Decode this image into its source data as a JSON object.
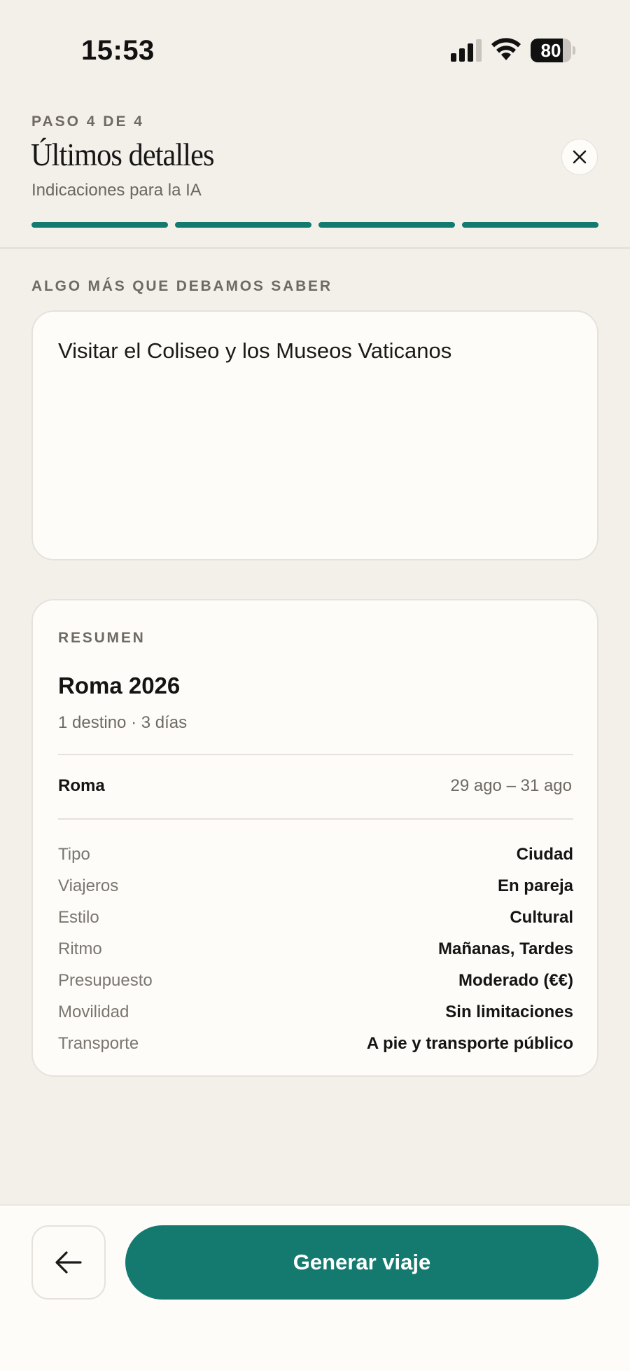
{
  "status_bar": {
    "time": "15:53",
    "battery_level": "80",
    "battery_fraction": 0.8,
    "icons": [
      "signal-icon",
      "wifi-icon",
      "battery-icon"
    ]
  },
  "header": {
    "step": "PASO 4 DE 4",
    "title": "Últimos detalles",
    "subtitle": "Indicaciones para la IA",
    "close_icon": "close-icon",
    "progress": {
      "completed_steps": 4,
      "total_steps": 4
    }
  },
  "notes": {
    "label": "ALGO MÁS QUE DEBAMOS SABER",
    "value": "Visitar el Coliseo y los Museos Vaticanos"
  },
  "summary": {
    "label": "RESUMEN",
    "trip_name": "Roma 2026",
    "trip_meta": "1 destino · 3 días",
    "destination": {
      "name": "Roma",
      "dates": "29 ago – 31 ago"
    },
    "details": [
      {
        "key": "Tipo",
        "value": "Ciudad"
      },
      {
        "key": "Viajeros",
        "value": "En pareja"
      },
      {
        "key": "Estilo",
        "value": "Cultural"
      },
      {
        "key": "Ritmo",
        "value": "Mañanas, Tardes"
      },
      {
        "key": "Presupuesto",
        "value": "Moderado (€€)"
      },
      {
        "key": "Movilidad",
        "value": "Sin limitaciones"
      },
      {
        "key": "Transporte",
        "value": "A pie y transporte público"
      }
    ]
  },
  "footer": {
    "back_icon": "arrow-left-icon",
    "generate_label": "Generar viaje"
  },
  "colors": {
    "accent": "#147a6f",
    "background": "#f3efe9",
    "card": "#fdfcf8",
    "muted_text": "#6e6a63"
  }
}
